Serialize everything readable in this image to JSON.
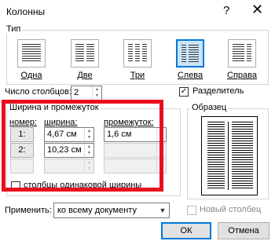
{
  "window": {
    "title": "Колонны",
    "help": "?",
    "close": "✕"
  },
  "type_group": {
    "label": "Тип",
    "presets": [
      {
        "label": "Одна",
        "cols": 1
      },
      {
        "label": "Две",
        "cols": 2
      },
      {
        "label": "Три",
        "cols": 3
      },
      {
        "label": "Слева",
        "cols": 2
      },
      {
        "label": "Справа",
        "cols": 2
      }
    ],
    "selected": "Слева"
  },
  "num_columns": {
    "label": "Число столбцов:",
    "value": "2"
  },
  "separator": {
    "label": "Разделитель",
    "checked": true,
    "mark": "✓"
  },
  "width_spacing": {
    "label": "Ширина и промежуток",
    "headers": {
      "number": "номер:",
      "width": "ширина:",
      "spacing": "промежуток:"
    },
    "rows": [
      {
        "number": "1:",
        "width": "4,67 см",
        "spacing": "1,6 см"
      },
      {
        "number": "2:",
        "width": "10,23 см",
        "spacing": ""
      },
      {
        "number": "",
        "width": "",
        "spacing": ""
      }
    ],
    "equal_width": {
      "label": "столбцы одинаковой ширины",
      "checked": false
    }
  },
  "sample": {
    "label": "Образец"
  },
  "apply": {
    "label": "Применить:",
    "value": "ко всему документу"
  },
  "new_column": {
    "label": "Новый столбец",
    "checked": false
  },
  "buttons": {
    "ok": "ОК",
    "cancel": "Отмена"
  },
  "colors": {
    "highlight_border": "#e8101c",
    "selection_blue": "#0078d7"
  }
}
